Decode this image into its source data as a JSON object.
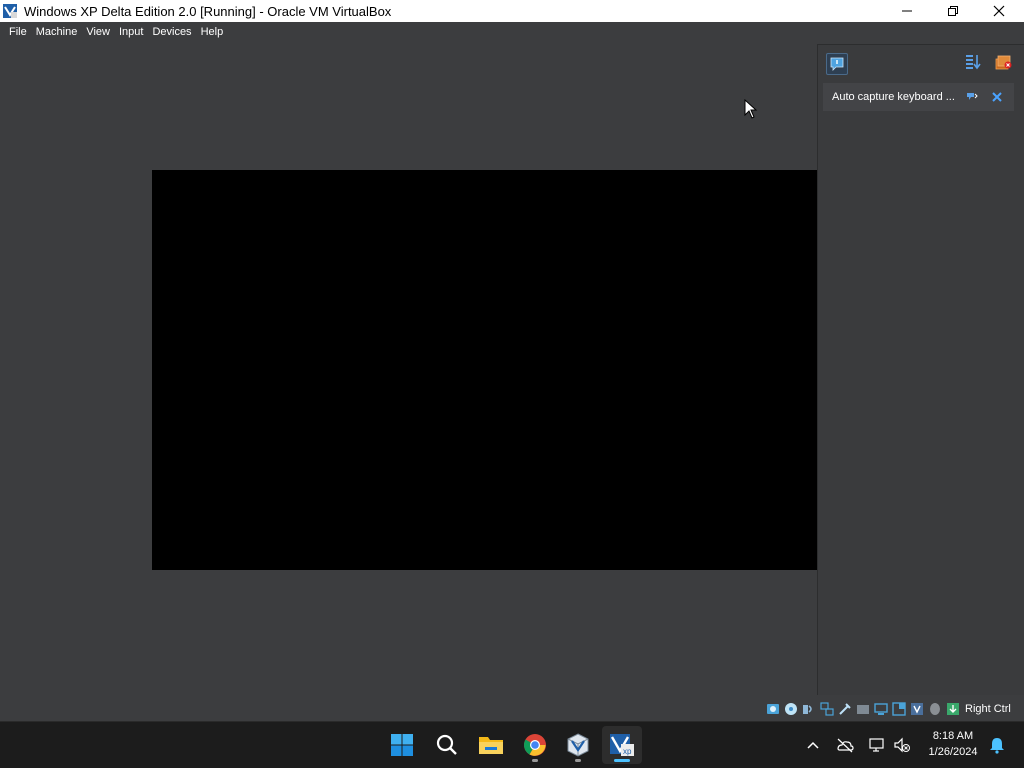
{
  "window": {
    "title": "Windows XP Delta Edition 2.0 [Running] - Oracle VM VirtualBox",
    "app_icon": "virtualbox-vm-icon",
    "controls": [
      "minimize-icon",
      "restore-icon",
      "close-icon"
    ]
  },
  "menu": {
    "items": [
      "File",
      "Machine",
      "View",
      "Input",
      "Devices",
      "Help"
    ]
  },
  "notification_center": {
    "toggle_icon": "notification-center-icon",
    "sort_icon": "sort-icon",
    "clear_icon": "clear-all-icon",
    "items": [
      {
        "text": "Auto capture keyboard ...",
        "pin_icon": "pin-icon",
        "close_icon": "close-icon"
      }
    ]
  },
  "statusbar": {
    "icons": [
      "hard-disk-icon",
      "optical-drive-icon",
      "audio-icon",
      "network-icon",
      "usb-icon",
      "shared-folders-icon",
      "display-icon",
      "recording-icon",
      "virtualization-icon",
      "mouse-integration-icon",
      "keyboard-capture-icon"
    ],
    "host_key": "Right Ctrl"
  },
  "taskbar": {
    "apps": [
      "start-icon",
      "search-icon",
      "file-explorer-icon",
      "chrome-icon",
      "virtualbox-manager-icon",
      "windows-xp-vm-icon"
    ],
    "tray_icons": [
      "show-hidden-icons-icon",
      "onedrive-icon",
      "network-icon",
      "volume-muted-icon"
    ],
    "time": "8:18 AM",
    "date": "1/26/2024",
    "notification_icon": "notification-bell-icon"
  },
  "colors": {
    "background": "#3c3d3f",
    "titlebar": "#ffffff",
    "vm_screen": "#000000",
    "taskbar": "#1c1c1c",
    "accent": "#4cc2ff"
  }
}
